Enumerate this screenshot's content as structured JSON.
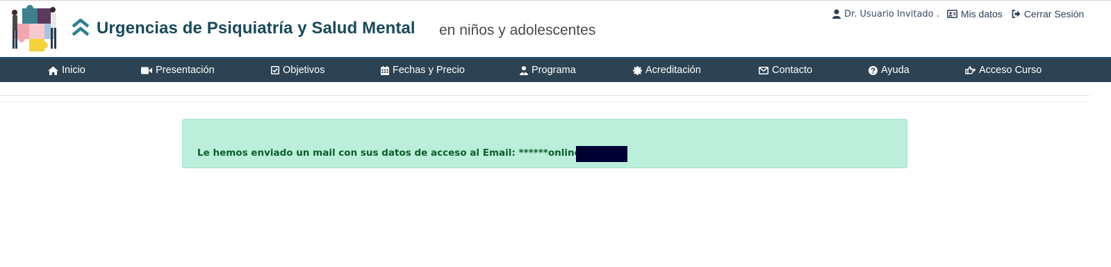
{
  "header": {
    "title": "Urgencias de Psiquiatría y Salud Mental",
    "subtitle": "en niños y adolescentes"
  },
  "user_bar": {
    "user_name": "Dr. Usuario Invitado .",
    "mis_datos": "Mis datos",
    "cerrar_sesion": "Cerrar Sesión"
  },
  "nav": {
    "items": [
      {
        "label": "Inicio",
        "icon": "home-icon"
      },
      {
        "label": "Presentación",
        "icon": "video-camera-icon"
      },
      {
        "label": "Objetivos",
        "icon": "checkbox-icon"
      },
      {
        "label": "Fechas y Precio",
        "icon": "calendar-icon"
      },
      {
        "label": "Programa",
        "icon": "user-tie-icon"
      },
      {
        "label": "Acreditación",
        "icon": "certificate-icon"
      },
      {
        "label": "Contacto",
        "icon": "envelope-icon"
      },
      {
        "label": "Ayuda",
        "icon": "question-circle-icon"
      },
      {
        "label": "Acceso Curso",
        "icon": "hand-pointer-icon"
      }
    ]
  },
  "alert": {
    "message": "Le hemos enviado un mail con sus datos de acceso al Email: ******online@c"
  },
  "colors": {
    "nav_background": "#2d4353",
    "title": "#174a5a",
    "alert_background": "#bbeedb",
    "alert_text": "#0b5e28"
  }
}
